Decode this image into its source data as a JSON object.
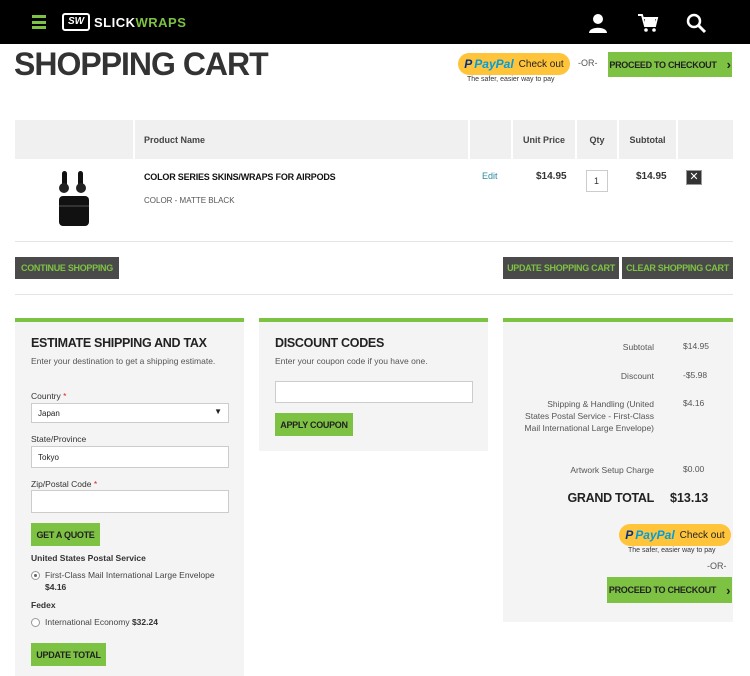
{
  "header": {
    "brand_prefix": "SW",
    "brand_main": "SLICK",
    "brand_accent": "WRAPS",
    "icons": [
      "menu-icon",
      "user-icon",
      "cart-icon",
      "search-icon"
    ]
  },
  "page_title": "SHOPPING CART",
  "checkout_top": {
    "paypal_label": "Check out",
    "paypal_tagline": "The safer, easier way to pay",
    "or_label": "-OR-",
    "proceed_label": "PROCEED TO CHECKOUT"
  },
  "table": {
    "headers": [
      "Product Name",
      "Unit Price",
      "Qty",
      "Subtotal"
    ],
    "rows": [
      {
        "name": "COLOR SERIES SKINS/WRAPS FOR AIRPODS",
        "option": "COLOR - MATTE BLACK",
        "edit_label": "Edit",
        "unit_price": "$14.95",
        "qty": "1",
        "subtotal": "$14.95"
      }
    ]
  },
  "cart_actions": {
    "continue_label": "CONTINUE SHOPPING",
    "update_label": "UPDATE SHOPPING CART",
    "clear_label": "CLEAR SHOPPING CART"
  },
  "shipping": {
    "title": "ESTIMATE SHIPPING AND TAX",
    "intro": "Enter your destination to get a shipping estimate.",
    "country_label": "Country",
    "country_value": "Japan",
    "state_label": "State/Province",
    "state_value": "Tokyo",
    "zip_label": "Zip/Postal Code",
    "zip_value": "",
    "quote_label": "GET A QUOTE",
    "carrier_usps": "United States Postal Service",
    "usps_rate": "First-Class Mail International Large Envelope",
    "usps_price": "$4.16",
    "carrier_fedex": "Fedex",
    "fedex_rate": "International Economy",
    "fedex_price": "$32.24",
    "update_total_label": "UPDATE TOTAL"
  },
  "discount": {
    "title": "DISCOUNT CODES",
    "intro": "Enter your coupon code if you have one.",
    "coupon_value": "",
    "apply_label": "APPLY COUPON"
  },
  "totals": {
    "subtotal_label": "Subtotal",
    "subtotal_value": "$14.95",
    "discount_label": "Discount",
    "discount_value": "-$5.98",
    "shipping_label": "Shipping & Handling (United States Postal Service - First-Class Mail International Large Envelope)",
    "shipping_value": "$4.16",
    "setup_label": "Artwork Setup Charge",
    "setup_value": "$0.00",
    "grand_label": "GRAND TOTAL",
    "grand_value": "$13.13"
  },
  "checkout_bottom": {
    "paypal_label": "Check out",
    "paypal_tagline": "The safer, easier way to pay",
    "or_label": "-OR-",
    "proceed_label": "PROCEED TO CHECKOUT"
  },
  "colors": {
    "accent": "#7dc242",
    "dark_button": "#4a4a4a",
    "paypal_yellow": "#ffc439"
  }
}
